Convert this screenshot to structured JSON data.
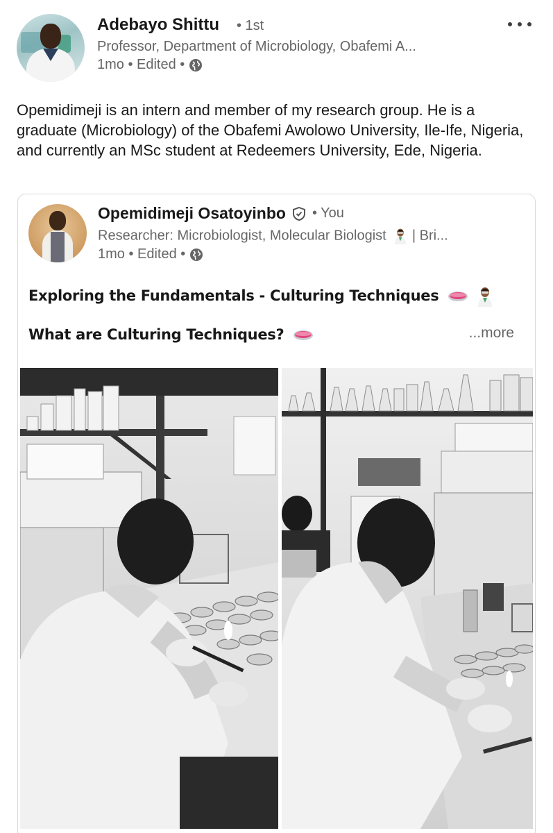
{
  "post": {
    "author": {
      "name": "Adebayo Shittu",
      "degree": "• 1st",
      "headline": "Professor, Department of Microbiology, Obafemi A...",
      "time": "1mo • Edited •"
    },
    "commentary": "Opemidimeji is an intern and member of my research group. He is a graduate (Microbiology) of the Obafemi Awolowo University, Ile-Ife, Nigeria, and currently an MSc student at Redeemers University, Ede, Nigeria."
  },
  "shared": {
    "author": {
      "name": "Opemidimeji Osatoyinbo",
      "badge": "• You",
      "headline_start": "Researcher: Microbiologist, Molecular Biologist",
      "headline_end": "| Bri...",
      "time": "1mo • Edited •"
    },
    "title": "Exploring the Fundamentals - Culturing Techniques",
    "question": "What are Culturing Techniques?",
    "see_more": "...more"
  },
  "icons": {
    "options": "more-options-icon",
    "visibility": "globe-icon",
    "verified": "verified-shield-icon",
    "petri_dish": "petri-dish-emoji",
    "scientist": "scientist-emoji"
  },
  "colors": {
    "text_primary": "#191919",
    "text_secondary": "#666666",
    "card_border": "#d9d9d9",
    "petri_dish": "#e0457b"
  }
}
